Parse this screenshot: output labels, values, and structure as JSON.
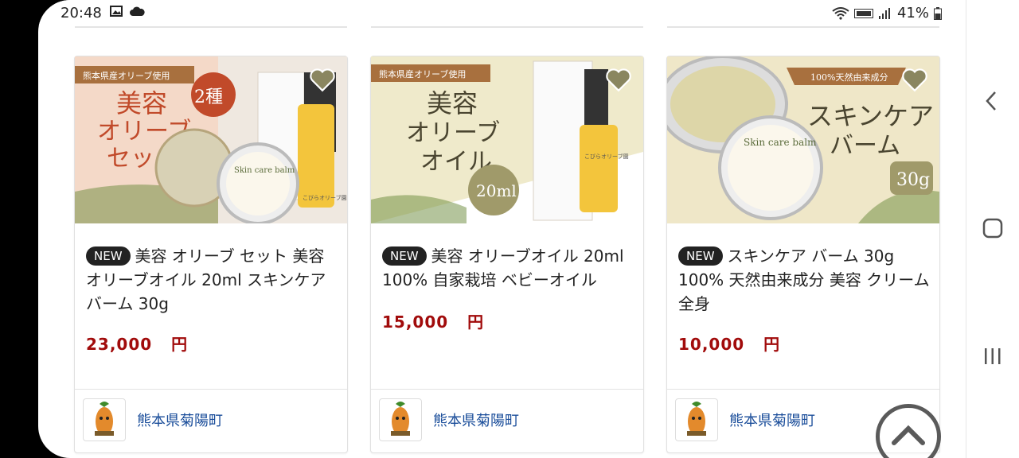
{
  "status": {
    "time": "20:48",
    "battery": "41%"
  },
  "products": [
    {
      "badge": "NEW",
      "title": "美容 オリーブ セット 美容オリーブオイル 20ml スキンケアバーム 30g",
      "price": "23,000",
      "currency": "円",
      "shop": "熊本県菊陽町",
      "image": {
        "ribbon": "熊本県産オリーブ使用",
        "line1": "美容",
        "line2": "オリーブ",
        "line3": "セット",
        "tag": "2種",
        "jar": "Skin care balm",
        "bottle": "こびらオリーブ園"
      }
    },
    {
      "badge": "NEW",
      "title": "美容 オリーブオイル 20ml 100% 自家栽培 ベビーオイル",
      "price": "15,000",
      "currency": "円",
      "shop": "熊本県菊陽町",
      "image": {
        "ribbon": "熊本県産オリーブ使用",
        "line1": "美容",
        "line2": "オリーブ",
        "line3": "オイル",
        "tag": "20ml",
        "bottle": "こびらオリーブ園"
      }
    },
    {
      "badge": "NEW",
      "title": "スキンケア バーム 30g 100% 天然由来成分 美容 クリーム 全身",
      "price": "10,000",
      "currency": "円",
      "shop": "熊本県菊陽町",
      "image": {
        "ribbon": "100%天然由来成分",
        "line1": "スキンケア",
        "line2": "バーム",
        "tag": "30g",
        "jar": "Skin care balm"
      }
    }
  ]
}
